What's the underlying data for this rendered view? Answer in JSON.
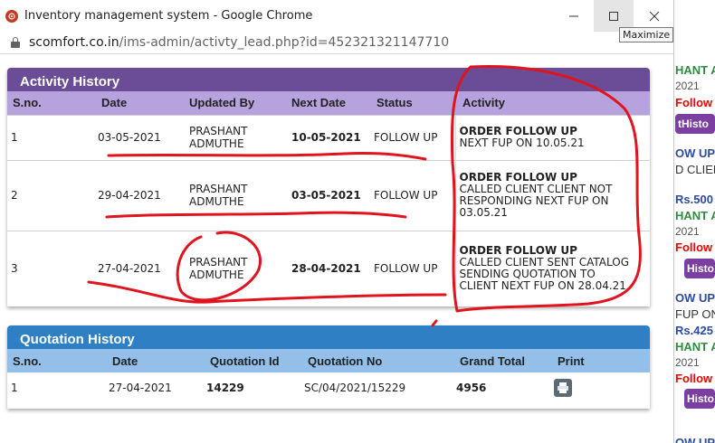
{
  "window": {
    "title": "Inventory management system - Google Chrome",
    "url_host": "scomfort.co.in",
    "url_path": "/ims-admin/activty_lead.php?id=452321321147710",
    "tooltip": "Maximize"
  },
  "activity": {
    "heading": "Activity History",
    "columns": [
      "S.no.",
      "Date",
      "Updated By",
      "Next Date",
      "Status",
      "Activity"
    ],
    "rows": [
      {
        "sno": "1",
        "date": "03-05-2021",
        "updated_by_1": "PRASHANT",
        "updated_by_2": "ADMUTHE",
        "next_date": "10-05-2021",
        "status": "FOLLOW UP",
        "activity_title": "ORDER FOLLOW UP",
        "activity_lines": [
          "NEXT FUP ON 10.05.21"
        ]
      },
      {
        "sno": "2",
        "date": "29-04-2021",
        "updated_by_1": "PRASHANT",
        "updated_by_2": "ADMUTHE",
        "next_date": "03-05-2021",
        "status": "FOLLOW UP",
        "activity_title": "ORDER FOLLOW UP",
        "activity_lines": [
          "CALLED CLIENT CLIENT NOT",
          "RESPONDING NEXT FUP ON",
          "03.05.21"
        ]
      },
      {
        "sno": "3",
        "date": "27-04-2021",
        "updated_by_1": "PRASHANT",
        "updated_by_2": "ADMUTHE",
        "next_date": "28-04-2021",
        "status": "FOLLOW UP",
        "activity_title": "ORDER FOLLOW UP",
        "activity_lines": [
          "CALLED CLIENT SENT CATALOG",
          "SENDING QUOTATION TO",
          "CLIENT NEXT FUP ON 28.04.21"
        ]
      }
    ]
  },
  "quotation": {
    "heading": "Quotation History",
    "columns": [
      "S.no.",
      "Date",
      "Quotation Id",
      "Quotation No",
      "Grand Total",
      "Print"
    ],
    "rows": [
      {
        "sno": "1",
        "date": "27-04-2021",
        "quotation_id": "14229",
        "quotation_no": "SC/04/2021/15229",
        "grand_total": "4956"
      }
    ]
  },
  "background_page": {
    "items": [
      "HANT A",
      "2021",
      "Follow",
      "tHisto",
      "OW UP",
      "D CLIEN",
      "Rs.500",
      "HANT A",
      "2021",
      "Follow",
      "Histo",
      "OW UP",
      "FUP ON",
      "Rs.425",
      "HANT A",
      "2021",
      "Follow",
      "Histo",
      "OW UP"
    ]
  },
  "colors": {
    "activity_header": "#6a4d96",
    "activity_columns": "#b6a2dd",
    "quotation_header": "#2f7fc4",
    "quotation_columns": "#93bfe9",
    "annotation_red": "#e0141e"
  },
  "icons": [
    "app-icon",
    "lock-icon",
    "minimize-icon",
    "maximize-icon",
    "close-icon",
    "print-icon"
  ]
}
